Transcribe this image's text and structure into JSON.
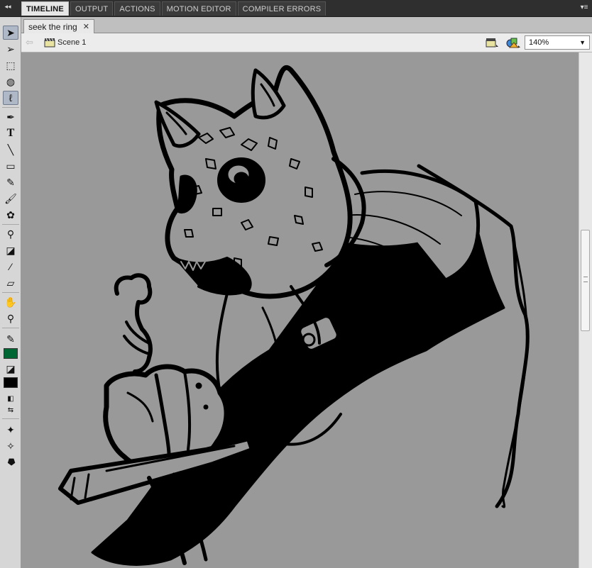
{
  "panel": {
    "tabs": [
      "TIMELINE",
      "OUTPUT",
      "ACTIONS",
      "MOTION EDITOR",
      "COMPILER ERRORS"
    ],
    "active_tab": "TIMELINE",
    "collapse_glyph": "◂◂",
    "menu_glyph": "▾≡"
  },
  "document": {
    "tab_label": "seek the ring",
    "close_glyph": "✕"
  },
  "edit_bar": {
    "back_glyph": "⇦",
    "scene_label": "Scene 1",
    "zoom_value": "140%"
  },
  "toolbar": {
    "tools": [
      {
        "name": "selection-tool-icon",
        "glyph": "➤",
        "selected": true
      },
      {
        "name": "subselection-tool-icon",
        "glyph": "➢"
      },
      {
        "name": "free-transform-tool-icon",
        "glyph": "⬚"
      },
      {
        "name": "3d-rotation-tool-icon",
        "glyph": "◍"
      },
      {
        "name": "lasso-tool-icon",
        "glyph": "ℓ",
        "selected": true
      },
      {
        "name": "pen-tool-icon",
        "glyph": "✒"
      },
      {
        "name": "text-tool-icon",
        "glyph": "T"
      },
      {
        "name": "line-tool-icon",
        "glyph": "╲"
      },
      {
        "name": "rectangle-tool-icon",
        "glyph": "▭"
      },
      {
        "name": "pencil-tool-icon",
        "glyph": "✎"
      },
      {
        "name": "brush-tool-icon",
        "glyph": "🖌"
      },
      {
        "name": "deco-tool-icon",
        "glyph": "✿"
      },
      {
        "name": "bone-tool-icon",
        "glyph": "⚲"
      },
      {
        "name": "paint-bucket-tool-icon",
        "glyph": "◪"
      },
      {
        "name": "eyedropper-tool-icon",
        "glyph": "⁄"
      },
      {
        "name": "eraser-tool-icon",
        "glyph": "▱"
      },
      {
        "name": "hand-tool-icon",
        "glyph": "✋"
      },
      {
        "name": "zoom-tool-icon",
        "glyph": "⚲"
      }
    ],
    "stroke_color": "#006633",
    "fill_color": "#000000"
  }
}
